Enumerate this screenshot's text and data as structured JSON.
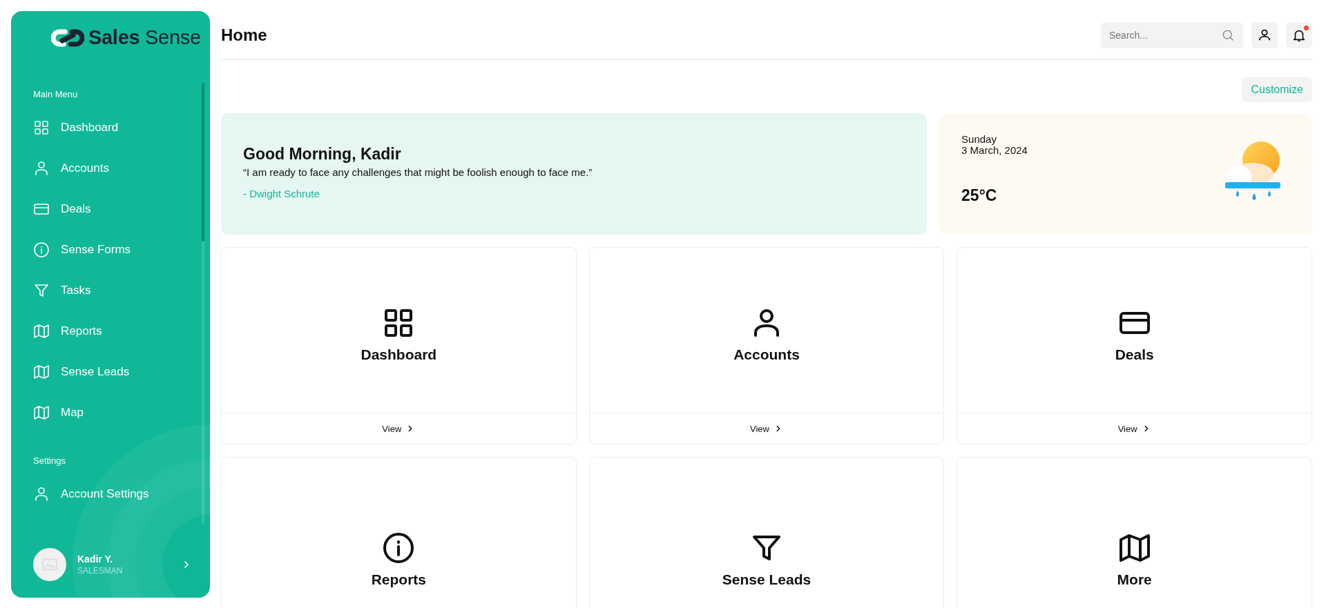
{
  "sidebar": {
    "logo": "**Sales** Sense",
    "sections": [
      {
        "title": "Main Menu",
        "items": [
          {
            "label": "Dashboard",
            "kind": "grid"
          },
          {
            "label": "Accounts",
            "kind": "person"
          },
          {
            "label": "Deals",
            "kind": "card"
          },
          {
            "label": "Sense Forms",
            "kind": "info"
          },
          {
            "label": "Tasks",
            "kind": "filter"
          },
          {
            "label": "Reports",
            "kind": "map"
          },
          {
            "label": "Sense Leads",
            "kind": "map"
          },
          {
            "label": "Map",
            "kind": "map"
          }
        ]
      },
      {
        "title": "Settings",
        "items": [
          {
            "label": "Account Settings",
            "kind": "person"
          }
        ]
      }
    ],
    "profile": {
      "name": "Kadir Y.",
      "role": "SALESMAN"
    }
  },
  "header": {
    "title": "Home",
    "search": {
      "placeholder": "Search..."
    },
    "notifications": {
      "unread": true
    }
  },
  "customize_button": "Customize",
  "greeting": {
    "title": "Good Morning, Kadir",
    "quote": "“I am ready to face any challenges that might be foolish enough to face me.”",
    "author": "- Dwight Schrute"
  },
  "weather": {
    "day": "Sunday",
    "date": "3 March, 2024",
    "temperature": "25°C"
  },
  "cards": [
    {
      "title": "Dashboard",
      "kind": "grid",
      "link": "View"
    },
    {
      "title": "Accounts",
      "kind": "person",
      "link": "View"
    },
    {
      "title": "Deals",
      "kind": "card",
      "link": "View"
    },
    {
      "title": "Reports",
      "kind": "info"
    },
    {
      "title": "Sense Leads",
      "kind": "filter"
    },
    {
      "title": "More",
      "kind": "map"
    }
  ]
}
